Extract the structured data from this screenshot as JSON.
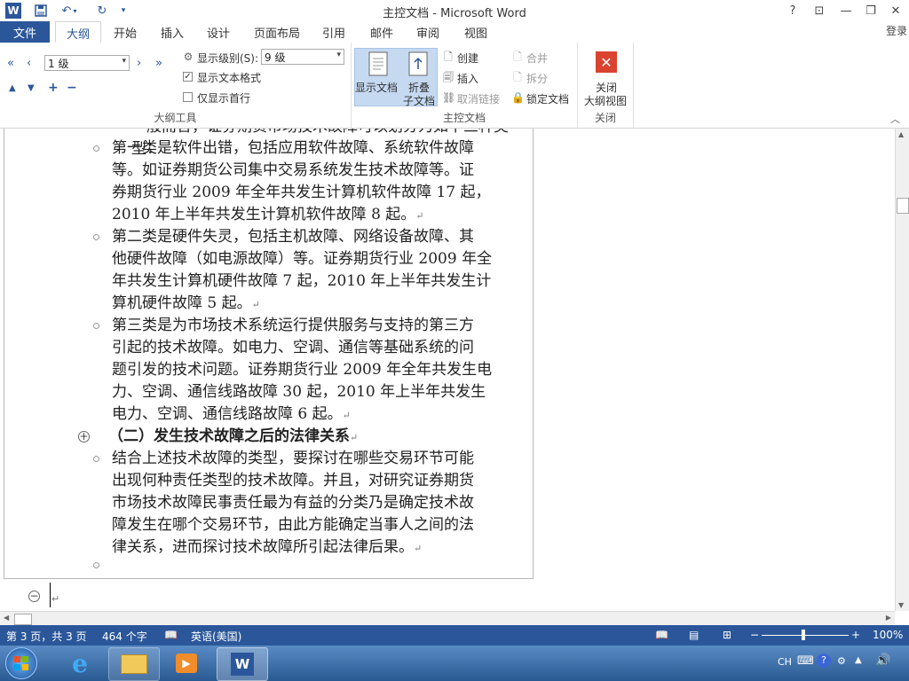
{
  "window": {
    "title": "主控文档 - Microsoft Word"
  },
  "window_controls": {
    "help": "?",
    "ribbon_display": "⊡",
    "minimize": "—",
    "restore": "❐",
    "close": "✕"
  },
  "tabs": {
    "file": "文件",
    "items": [
      "大纲",
      "开始",
      "插入",
      "设计",
      "页面布局",
      "引用",
      "邮件",
      "审阅",
      "视图"
    ],
    "active": "大纲",
    "login": "登录"
  },
  "ribbon": {
    "outline_tools": {
      "level_select": "1 级",
      "show_level_label": "显示级别(S):",
      "show_level_value": "9 级",
      "show_text_format": "显示文本格式",
      "show_text_format_checked": true,
      "show_first_line": "仅显示首行",
      "show_first_line_checked": false,
      "group_label": "大纲工具"
    },
    "master_document": {
      "show_document": "显示文档",
      "collapse_line1": "折叠",
      "collapse_line2": "子文档",
      "create": "创建",
      "insert": "插入",
      "unlink": "取消链接",
      "merge": "合并",
      "split": "拆分",
      "lock": "锁定文档",
      "group_label": "主控文档"
    },
    "close_group": {
      "close_line1": "关闭",
      "close_line2": "大纲视图",
      "group_label": "关闭"
    }
  },
  "document": {
    "top_partial": "一般而言，证券期货市场技术故障可以划分为如下三种类型：",
    "paragraphs": [
      {
        "lines": [
          "第一类是软件出错，包括应用软件故障、系统软件故障",
          "等。如证券期货公司集中交易系统发生技术故障等。证",
          "券期货行业 2009 年全年共发生计算机软件故障 17 起，",
          "2010 年上半年共发生计算机软件故障 8 起。"
        ]
      },
      {
        "lines": [
          "第二类是硬件失灵，包括主机故障、网络设备故障、其",
          "他硬件故障（如电源故障）等。证券期货行业 2009 年全",
          "年共发生计算机硬件故障 7 起，2010 年上半年共发生计",
          "算机硬件故障 5 起。"
        ]
      },
      {
        "lines": [
          "第三类是为市场技术系统运行提供服务与支持的第三方",
          "引起的技术故障。如电力、空调、通信等基础系统的问",
          "题引发的技术问题。证券期货行业 2009 年全年共发生电",
          "力、空调、通信线路故障 30 起，2010 年上半年共发生",
          "电力、空调、通信线路故障 6 起。"
        ]
      }
    ],
    "heading": "（二）发生技术故障之后的法律关系",
    "paragraph_after_heading": {
      "lines": [
        "结合上述技术故障的类型，要探讨在哪些交易环节可能",
        "出现何种责任类型的技术故障。并且，对研究证券期货",
        "市场技术故障民事责任最为有益的分类乃是确定技术故",
        "障发生在哪个交易环节，由此方能确定当事人之间的法",
        "律关系，进而探讨技术故障所引起法律后果。"
      ]
    },
    "paragraph_mark": "↵"
  },
  "status": {
    "page": "第 3 页，共 3 页",
    "words": "464 个字",
    "language": "英语(美国)",
    "zoom": "100%",
    "zoom_level": 1.0
  },
  "taskbar": {
    "ime": "CH",
    "apps": [
      "start-orb",
      "internet-explorer",
      "file-explorer",
      "media-player",
      "word"
    ]
  },
  "colors": {
    "accent": "#2b579a",
    "close_red": "#d9432f",
    "master_selected": "#c5d9f1"
  }
}
